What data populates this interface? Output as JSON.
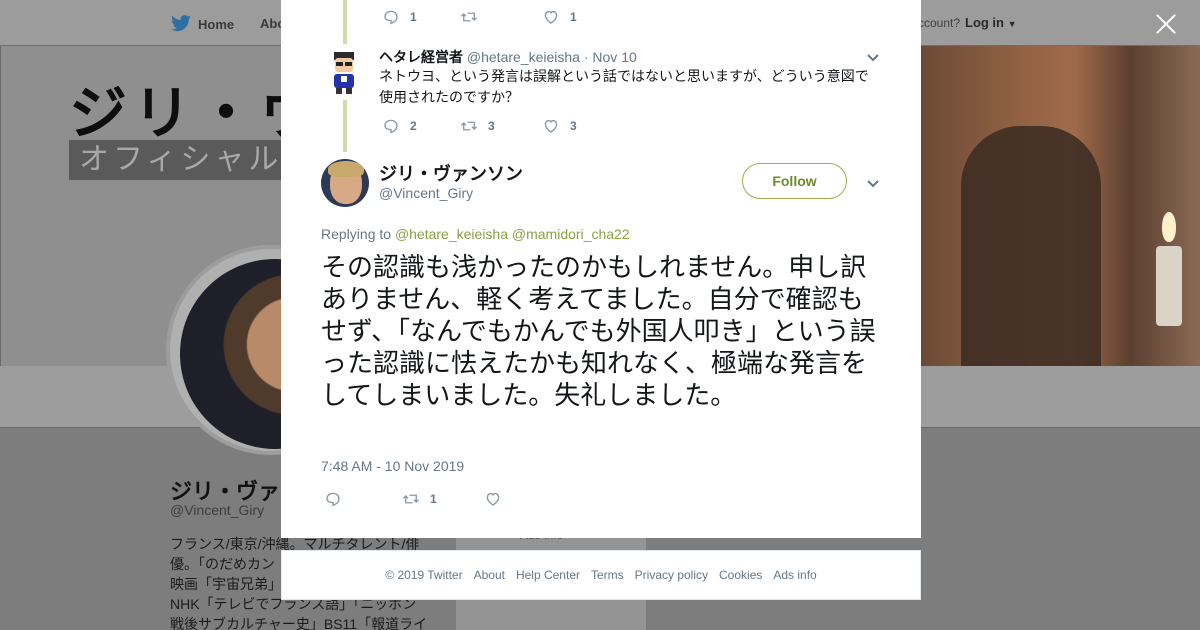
{
  "nav": {
    "home_label": "Home",
    "about_label": "Abo",
    "account_label": "ccount?",
    "login_label": "Log in"
  },
  "banner": {
    "title": "ジリ・ヴ",
    "subtitle": "オフィシャル"
  },
  "profile": {
    "name": "ジリ・ヴァ",
    "handle": "@Vincent_Giry",
    "bio_lines": [
      "フランス/東京/沖縄。マルチタレント/俳",
      "優。「のだめカン",
      "映画「宇宙兄弟」",
      "NHK「テレビでフランス語」「ニッポン",
      "戦後サブカルチャー史」BS11「報道ライ"
    ],
    "ads_info": "Ads info"
  },
  "top_tweet_actions": {
    "replies": "1",
    "retweets": "",
    "likes": "1"
  },
  "reply_tweet": {
    "name": "ヘタレ経営者",
    "handle": "@hetare_keieisha",
    "separator": "·",
    "date": "Nov 10",
    "text": "ネトウヨ、という発言は誤解という話ではないと思いますが、どういう意図で使用されたのですか？",
    "replies": "2",
    "retweets": "3",
    "likes": "3"
  },
  "main_tweet": {
    "name": "ジリ・ヴァンソン",
    "handle": "@Vincent_Giry",
    "follow_label": "Follow",
    "replying_prefix": "Replying to",
    "mention_1": "@hetare_keieisha",
    "mention_2": "@mamidori_cha22",
    "text": "その認識も浅かったのかもしれません。申し訳ありません、軽く考えてました。自分で確認もせず、「なんでもかんでも外国人叩き」という誤った認識に怯えたかも知れなく、極端な発言をしてしまいました。失礼しました。",
    "timestamp": "7:48 AM - 10 Nov 2019",
    "replies": "",
    "retweets": "1",
    "likes": ""
  },
  "footer": {
    "copyright": "© 2019 Twitter",
    "about": "About",
    "help": "Help Center",
    "terms": "Terms",
    "privacy": "Privacy policy",
    "cookies": "Cookies",
    "ads": "Ads info"
  },
  "colors": {
    "accent": "#8aa241",
    "thread_line": "#cfd9a9",
    "secondary_text": "#657786",
    "overlay": "#7d7d7d"
  },
  "icons": {
    "twitter": "bird-icon",
    "close": "close-icon",
    "reply": "reply-icon",
    "retweet": "retweet-icon",
    "like": "heart-icon",
    "menu": "chevron-down-icon"
  }
}
